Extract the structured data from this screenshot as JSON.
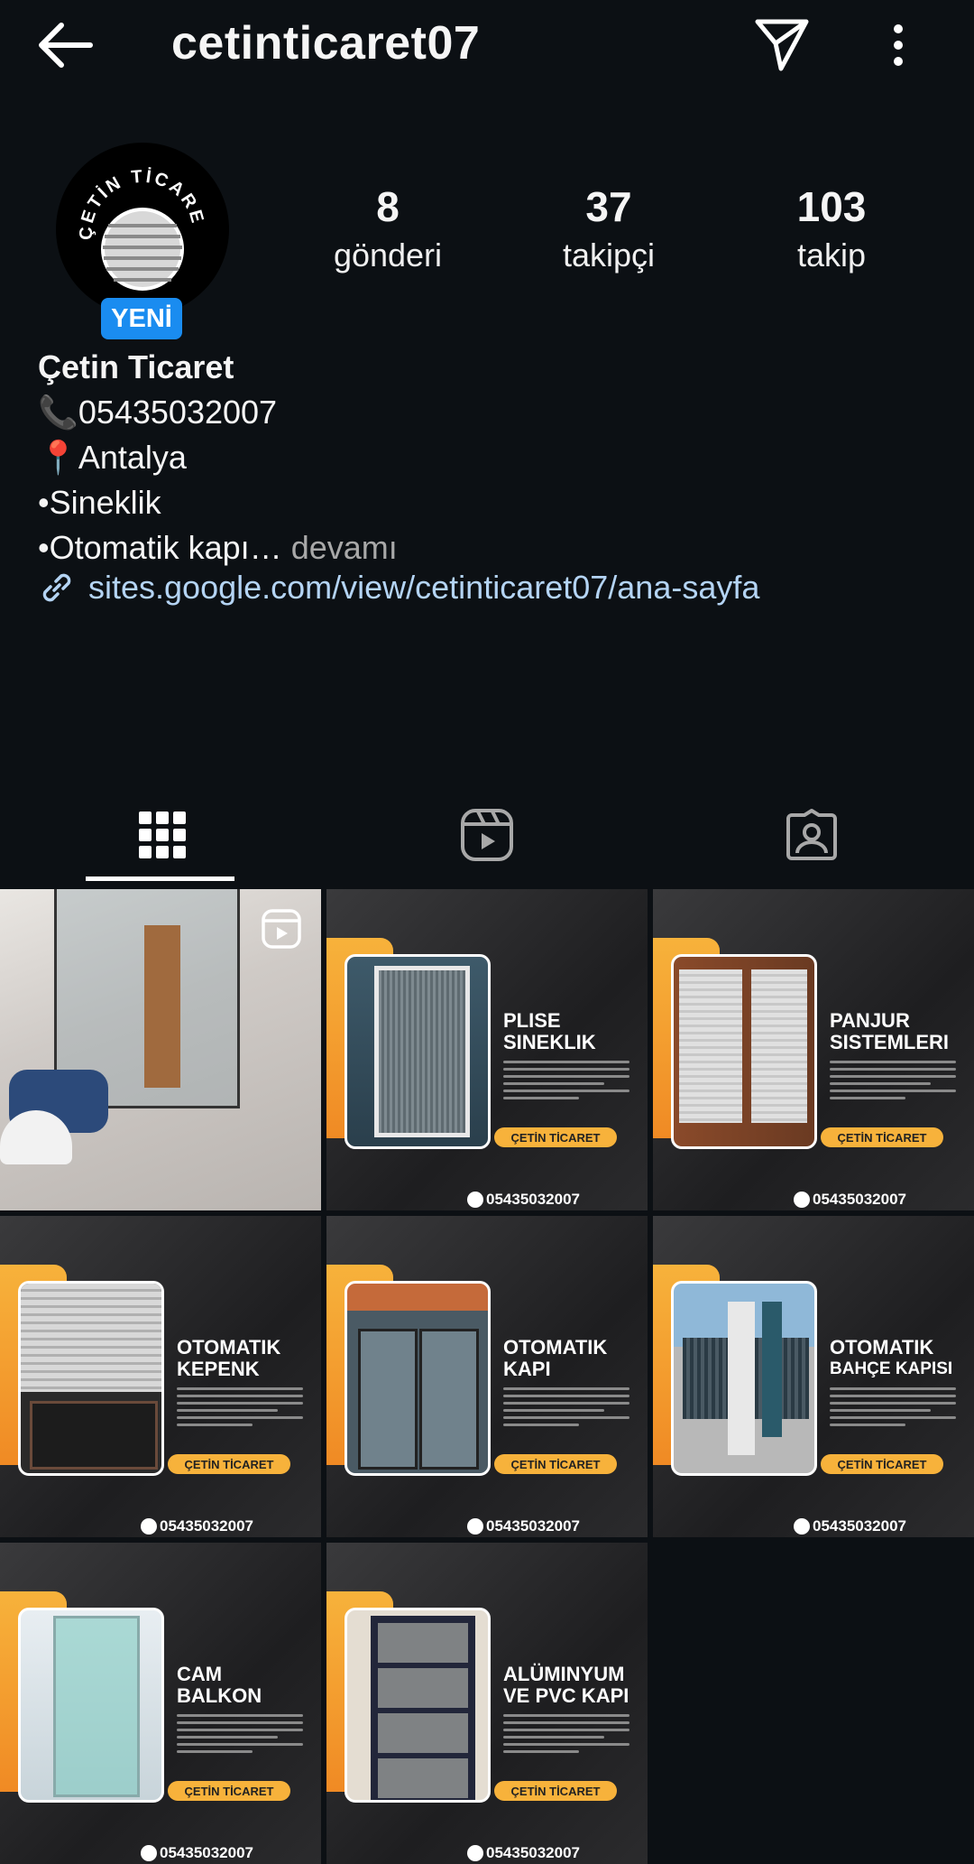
{
  "header": {
    "username": "cetinticaret07",
    "back_icon": "arrow-left-icon",
    "send_icon": "send-icon",
    "more_icon": "more-vertical-icon"
  },
  "profile": {
    "avatar_text": "ÇETİN TİCARET",
    "badge": "YENİ",
    "stats": [
      {
        "value": "8",
        "label": "gönderi"
      },
      {
        "value": "37",
        "label": "takipçi"
      },
      {
        "value": "103",
        "label": "takip"
      }
    ],
    "name": "Çetin Ticaret",
    "bio_lines": [
      "📞05435032007",
      "📍Antalya",
      "•Sineklik",
      "•Otomatik kapı…"
    ],
    "bio_more": "devamı",
    "link": "sites.google.com/view/cetinticaret07/ana-sayfa"
  },
  "tabs": [
    {
      "icon": "grid-icon",
      "active": true
    },
    {
      "icon": "reels-icon",
      "active": false
    },
    {
      "icon": "tagged-icon",
      "active": false
    }
  ],
  "posts": [
    {
      "type": "reel",
      "title_line1": "",
      "title_line2": "",
      "pill": "",
      "phone": ""
    },
    {
      "type": "card",
      "title_line1": "PLISE",
      "title_line2": "SINEKLIK",
      "pill": "ÇETİN TİCARET",
      "phone": "05435032007"
    },
    {
      "type": "card",
      "title_line1": "PANJUR",
      "title_line2": "SISTEMLERI",
      "pill": "ÇETİN TİCARET",
      "phone": "05435032007"
    },
    {
      "type": "card",
      "title_line1": "OTOMATIK",
      "title_line2": "KEPENK",
      "pill": "ÇETİN TİCARET",
      "phone": "05435032007"
    },
    {
      "type": "card",
      "title_line1": "OTOMATIK",
      "title_line2": "KAPI",
      "pill": "ÇETİN TİCARET",
      "phone": "05435032007"
    },
    {
      "type": "card",
      "title_line1": "OTOMATIK",
      "title_line2": "BAHÇE KAPISI",
      "pill": "ÇETİN TİCARET",
      "phone": "05435032007"
    },
    {
      "type": "card",
      "title_line1": "CAM",
      "title_line2": "BALKON",
      "pill": "ÇETİN TİCARET",
      "phone": "05435032007"
    },
    {
      "type": "card",
      "title_line1": "ALÜMINYUM",
      "title_line2": "VE PVC KAPI",
      "pill": "ÇETİN TİCARET",
      "phone": "05435032007"
    }
  ]
}
